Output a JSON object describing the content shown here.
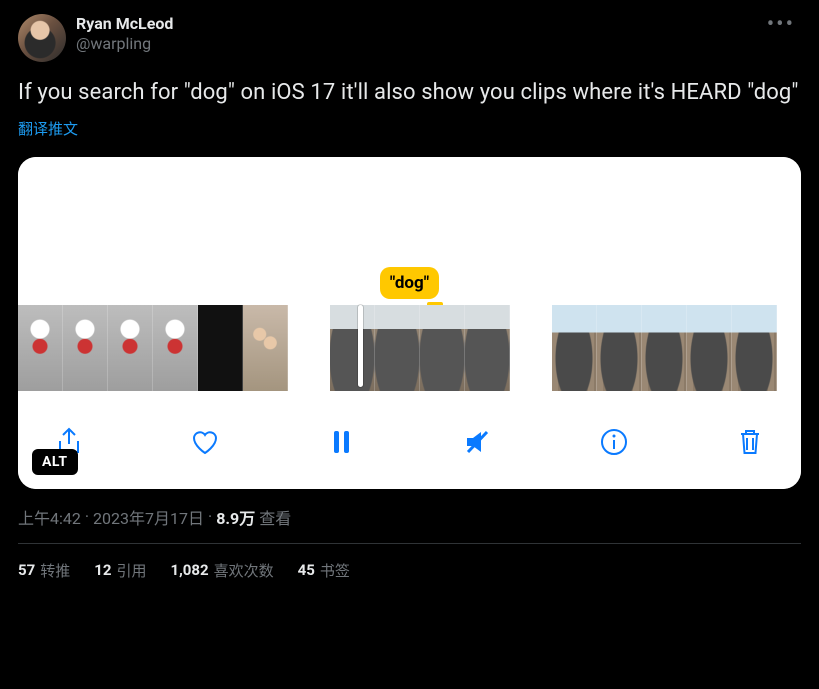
{
  "author": {
    "display_name": "Ryan McLeod",
    "handle": "@warpling"
  },
  "tweet_text": "If you search for \"dog\" on iOS 17 it'll also show you clips where it's HEARD \"dog\"",
  "translate_label": "翻译推文",
  "media": {
    "tag_label": "\"dog\"",
    "alt_badge": "ALT"
  },
  "meta": {
    "time": "上午4:42",
    "sep1": " · ",
    "date": "2023年7月17日",
    "sep2": " · ",
    "views_count": "8.9万",
    "views_label": " 查看"
  },
  "stats": {
    "retweets": {
      "count": "57",
      "label": "转推"
    },
    "quotes": {
      "count": "12",
      "label": "引用"
    },
    "likes": {
      "count": "1,082",
      "label": "喜欢次数"
    },
    "bookmarks": {
      "count": "45",
      "label": "书签"
    }
  }
}
